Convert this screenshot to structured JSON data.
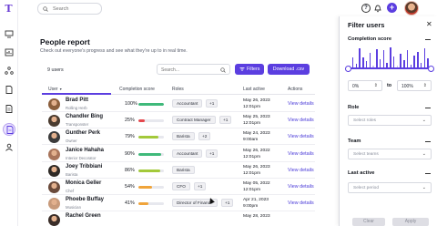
{
  "logo": "T",
  "top": {
    "search_placeholder": "Search",
    "help": "?",
    "add": "+"
  },
  "page": {
    "title": "People report",
    "subtitle": "Check out everyone's progress and see what they're up to in real time."
  },
  "toolbar": {
    "count": "9 users",
    "search_placeholder": "Search...",
    "filters_label": "Filters",
    "download_label": "Download .csv"
  },
  "table": {
    "headers": {
      "user": "User",
      "user_sort": "▼",
      "completion": "Completion score",
      "roles": "Roles",
      "last_active": "Last active",
      "actions": "Actions"
    },
    "rows": [
      {
        "name": "Brad Pitt",
        "title": "Rolling Herb",
        "pct_label": "100%",
        "pct": 100,
        "color": "#3fb97a",
        "role": "Accountant",
        "extra": "+1",
        "date": "May 26, 2023",
        "time": "12:01pm",
        "action": "View details"
      },
      {
        "name": "Chandler Bing",
        "title": "Transponster",
        "pct_label": "25%",
        "pct": 25,
        "color": "#e5484d",
        "role": "Contract Manager",
        "extra": "+1",
        "date": "May 25, 2023",
        "time": "12:01pm",
        "action": "View details"
      },
      {
        "name": "Gunther Perk",
        "title": "Owner",
        "pct_label": "79%",
        "pct": 79,
        "color": "#a3c93a",
        "role": "Barista",
        "extra": "+2",
        "date": "May 24, 2023",
        "time": "9:00am",
        "action": "View details"
      },
      {
        "name": "Janice Hahaha",
        "title": "Interior Decorator",
        "pct_label": "90%",
        "pct": 90,
        "color": "#3fb97a",
        "role": "Accountant",
        "extra": "+1",
        "date": "May 26, 2022",
        "time": "12:01pm",
        "action": "View details"
      },
      {
        "name": "Joey Tribbiani",
        "title": "Barista",
        "pct_label": "86%",
        "pct": 86,
        "color": "#a3c93a",
        "role": "Barista",
        "extra": "",
        "date": "May 26, 2023",
        "time": "12:01pm",
        "action": "View details"
      },
      {
        "name": "Monica Geller",
        "title": "Chef",
        "pct_label": "54%",
        "pct": 54,
        "color": "#f0a43a",
        "role": "CFO",
        "extra": "+1",
        "date": "May 05, 2022",
        "time": "12:01pm",
        "action": "View details"
      },
      {
        "name": "Phoebe Buffay",
        "title": "Musician",
        "pct_label": "41%",
        "pct": 41,
        "color": "#f0a43a",
        "role": "Director of Finance",
        "extra": "+1",
        "date": "Apr 21, 2023",
        "time": "9:00pm",
        "action": "View details"
      },
      {
        "name": "Rachel Green",
        "title": "",
        "pct_label": "",
        "pct": 0,
        "color": "#3fb97a",
        "role": "",
        "extra": "",
        "date": "May 28, 2023",
        "time": "",
        "action": ""
      }
    ]
  },
  "filter_panel": {
    "title": "Filter users",
    "completion_title": "Completion score",
    "min_value": "0%",
    "to_label": "to",
    "max_value": "100%",
    "role_title": "Role",
    "role_placeholder": "Select roles",
    "team_title": "Team",
    "team_placeholder": "Select teams",
    "last_active_title": "Last active",
    "last_active_placeholder": "Select period",
    "clear_label": "Clear",
    "apply_label": "Apply",
    "histogram": [
      0.05,
      0.5,
      0.18,
      0.95,
      0.5,
      0.3,
      0.75,
      0.1,
      0.92,
      0.4,
      0.85,
      0.22,
      0.98,
      0.55,
      0.08,
      0.7,
      0.35,
      0.88,
      0.15,
      0.6,
      0.78,
      0.25,
      0.95,
      0.45
    ]
  }
}
